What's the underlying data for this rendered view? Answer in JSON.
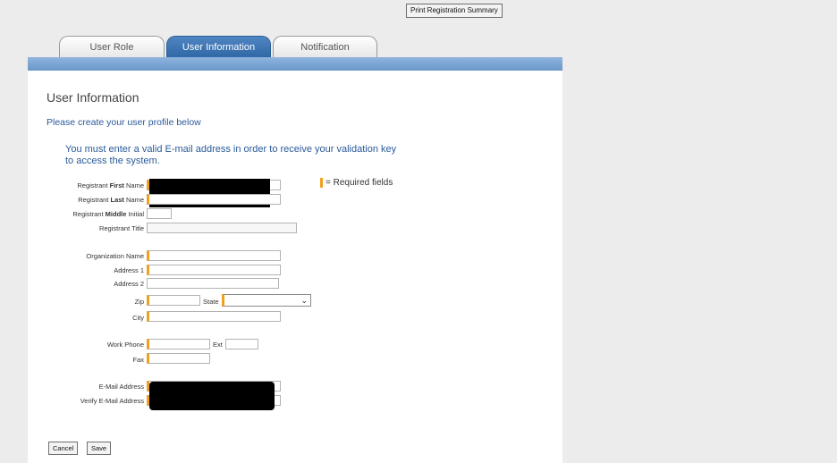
{
  "header": {
    "print_label": "Print Registration Summary"
  },
  "tabs": [
    {
      "label": "User Role",
      "active": false
    },
    {
      "label": "User Information",
      "active": true
    },
    {
      "label": "Notification",
      "active": false
    }
  ],
  "form": {
    "title": "User Information",
    "subtitle": "Please create your user profile below",
    "notice": "You must enter a valid E-mail address in order to receive your validation key to access the system.",
    "legend": "= Required fields",
    "labels": {
      "first_pre": "Registrant ",
      "first_bold": "First",
      "first_post": " Name",
      "last_pre": "Registrant ",
      "last_bold": "Last",
      "last_post": " Name",
      "middle_pre": "Registrant ",
      "middle_bold": "Middle",
      "middle_post": " Initial",
      "title": "Registrant Title",
      "org": "Organization Name",
      "address1": "Address 1",
      "address2": "Address 2",
      "zip": "Zip",
      "state": "State",
      "city": "City",
      "work_phone": "Work Phone",
      "ext": "Ext",
      "fax": "Fax",
      "email": "E-Mail Address",
      "verify_email": "Verify E-Mail Address"
    },
    "state_selected": ""
  },
  "actions": {
    "cancel": "Cancel",
    "save": "Save"
  },
  "colors": {
    "required_marker": "#f0a020",
    "tab_active": "#2f66a5",
    "accent_text": "#2a5a9a"
  }
}
